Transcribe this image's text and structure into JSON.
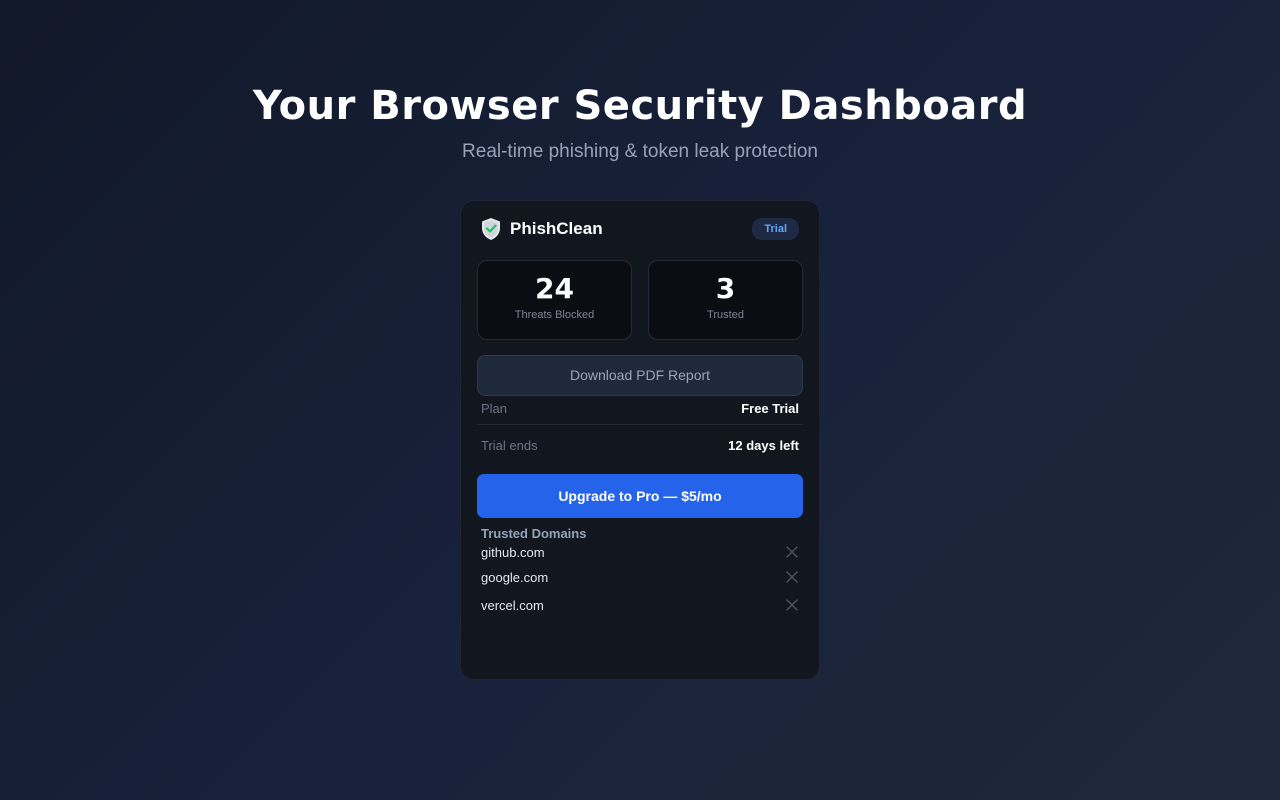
{
  "hero": {
    "title": "Your Browser Security Dashboard",
    "subtitle": "Real-time phishing & token leak protection"
  },
  "card": {
    "brand_name": "PhishClean",
    "brand_icon": "shield-check-icon",
    "badge": "Trial",
    "stats": [
      {
        "value": "24",
        "label": "Threats Blocked"
      },
      {
        "value": "3",
        "label": "Trusted"
      }
    ],
    "pdf_button": "Download PDF Report",
    "plan": {
      "label": "Plan",
      "value": "Free Trial"
    },
    "trial_ends": {
      "label": "Trial ends",
      "value": "12 days left"
    },
    "upgrade_button": "Upgrade to Pro — $5/mo",
    "domains_title": "Trusted Domains",
    "domains": [
      "github.com",
      "google.com",
      "vercel.com"
    ],
    "remove_icon": "close-icon"
  },
  "colors": {
    "accent": "#2563eb",
    "badge_text": "#60a5fa",
    "shield_check": "#22c55e",
    "card_bg": "#12161e"
  }
}
